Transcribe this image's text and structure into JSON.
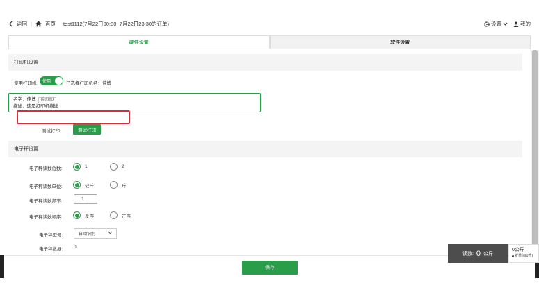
{
  "header": {
    "back": "返回",
    "home": "首页",
    "title": "test1112(7月22日00:30~7月22日23:30的订单)",
    "settings": "设置",
    "user": "我的"
  },
  "tabs": [
    {
      "label": "硬件设置",
      "active": true
    },
    {
      "label": "软件设置",
      "active": false
    }
  ],
  "printer": {
    "section_title": "打印机设置",
    "use_label": "使用打印机",
    "toggle_text": "使用",
    "selected_label": "已选择打印机名：佳博",
    "name_label": "名字：佳博",
    "name_tag": "系统默认",
    "desc_label": "描述：这是打印机描述",
    "test_label": "测试打印:",
    "test_button": "测试打印"
  },
  "scale": {
    "section_title": "电子秤设置",
    "digits_label": "电子秤读数位数:",
    "digits_options": [
      "1",
      "2"
    ],
    "unit_label": "电子秤读数单位:",
    "unit_options": [
      "公斤",
      "斤"
    ],
    "freq_label": "电子秤读数频率:",
    "freq_value": "1",
    "order_label": "电子秤读数顺序:",
    "order_options": [
      "反序",
      "正序"
    ],
    "model_label": "电子秤型号:",
    "model_value": "自动识别",
    "data_label": "电子秤数据:",
    "data_value": "0"
  },
  "footer": {
    "save": "保存"
  },
  "weight": {
    "label": "读数:",
    "value": "0",
    "unit": "公斤",
    "side_value": "0公斤",
    "side_note": "折重前(0千)"
  },
  "colors": {
    "accent": "#2a9d4a",
    "highlight": "#d32f3a"
  }
}
